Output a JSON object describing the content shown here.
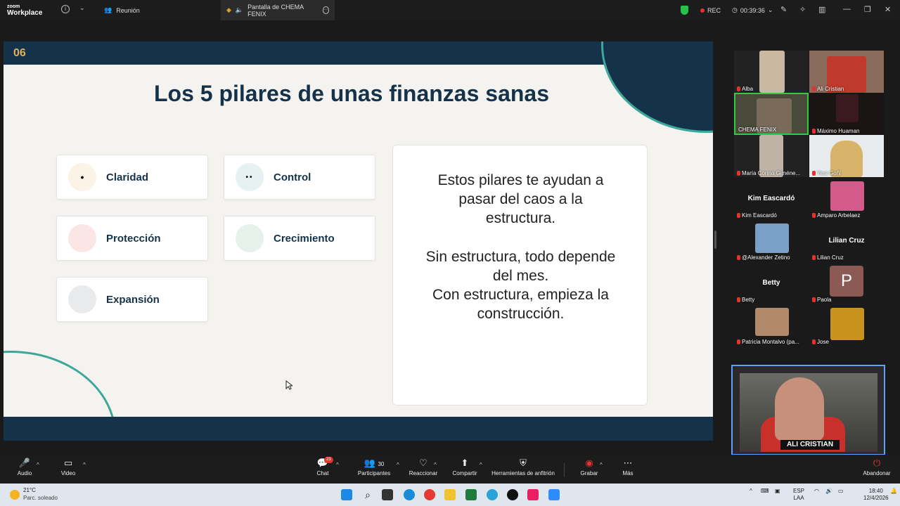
{
  "topbar": {
    "logo_line1": "zoom",
    "logo_line2": "Workplace",
    "info_icon": "info-icon",
    "meeting_tab": "Reunión",
    "share_tab": "Pantalla de CHEMA FENIX",
    "rec_label": "REC",
    "timer": "00:39:36",
    "security_color": "#27c24c"
  },
  "slide": {
    "number": "06",
    "title": "Los 5 pilares de unas finanzas sanas",
    "cards": [
      {
        "label": "Claridad",
        "glyph": "•",
        "circle_color": "#fbf3e6"
      },
      {
        "label": "Control",
        "glyph": "••",
        "circle_color": "#e8f1f1"
      },
      {
        "label": "Protección",
        "glyph": "",
        "circle_color": "#fbe6e6"
      },
      {
        "label": "Crecimiento",
        "glyph": "",
        "circle_color": "#e6f1ec"
      },
      {
        "label": "Expansión",
        "glyph": "",
        "circle_color": "#e9eaec"
      }
    ],
    "info_lines": [
      "Estos pilares te ayudan a",
      "pasar del caos a la",
      "estructura.",
      "Sin estructura, todo depende",
      "del mes.",
      "Con estructura, empieza la",
      "construcción."
    ],
    "accent_color": "#14334a",
    "deco_color": "#3fa79a"
  },
  "gallery": {
    "participants": [
      {
        "name": "Alba",
        "muted": true
      },
      {
        "name": "Ali Cristian",
        "muted": true
      },
      {
        "name": "CHEMA FENIX",
        "muted": false,
        "active": true
      },
      {
        "name": "Máximo Huaman",
        "muted": true
      },
      {
        "name": "María Corina Giméne...",
        "muted": true
      },
      {
        "name": "Yesi Goñi",
        "muted": true
      },
      {
        "name": "Kim Eascardó",
        "muted": true,
        "center": "Kim Eascardó"
      },
      {
        "name": "Amparo Arbelaez",
        "muted": true
      },
      {
        "name": "@Alexander Zetino",
        "muted": true
      },
      {
        "name": "Lilian Cruz",
        "muted": true,
        "center": "Lilian Cruz"
      },
      {
        "name": "Betty",
        "muted": true,
        "center": "Betty"
      },
      {
        "name": "Paola",
        "muted": true,
        "avatar_letter": "P"
      },
      {
        "name": "Patricia Montalvo (pa...",
        "muted": true
      },
      {
        "name": "Jose",
        "muted": true
      }
    ],
    "self_view_banner": "ALI CRISTIAN"
  },
  "toolbar": {
    "audio": "Audio",
    "video": "Video",
    "chat": "Chat",
    "chat_badge": "23",
    "participants": "Participantes",
    "participants_count": "30",
    "react": "Reaccionar",
    "share": "Compartir",
    "host_tools": "Herramientas de anfitrión",
    "record": "Grabar",
    "more": "Más",
    "leave": "Abandonar"
  },
  "taskbar": {
    "temp": "21°C",
    "weather": "Parc. soleado",
    "lang1": "ESP",
    "lang2": "LAA",
    "time": "18:40",
    "date": "12/4/2026"
  }
}
